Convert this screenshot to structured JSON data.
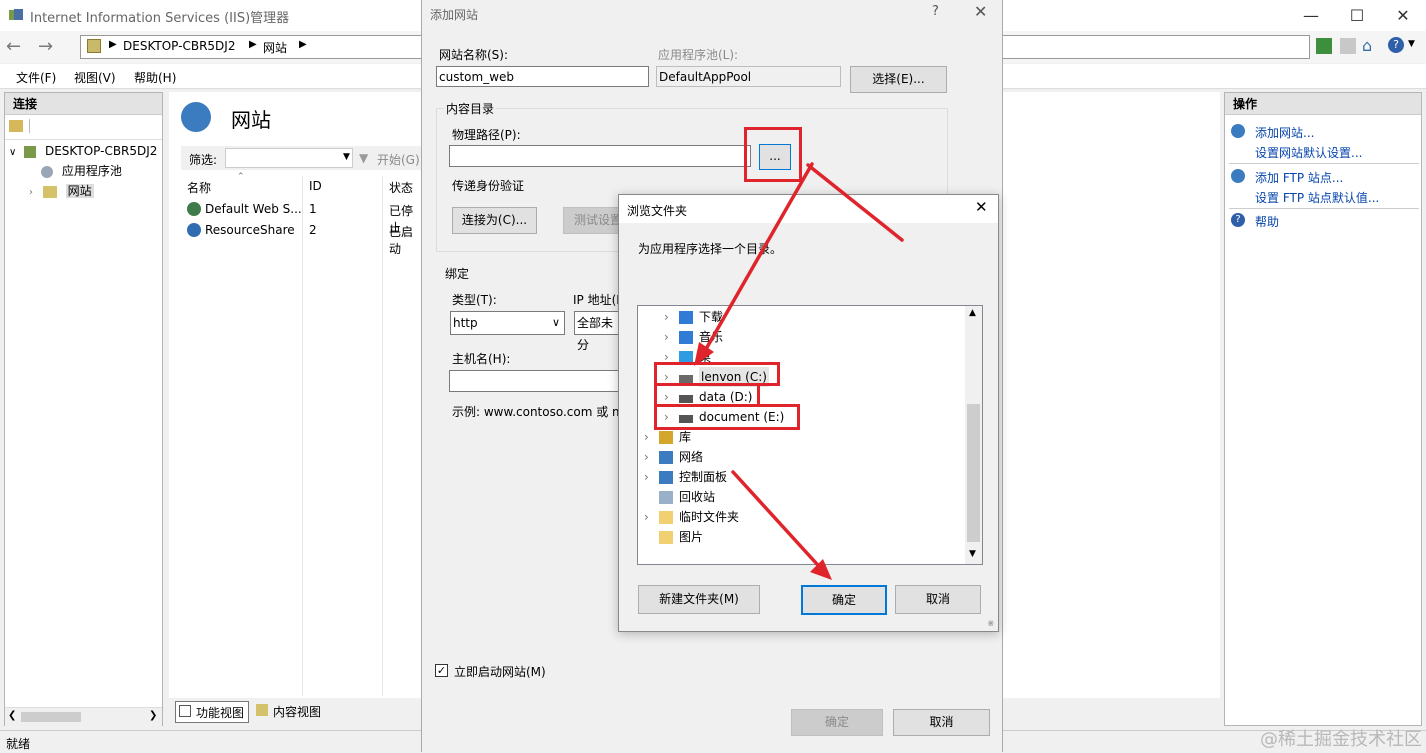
{
  "window": {
    "title": "Internet Information Services (IIS)管理器",
    "address_parts": [
      "DESKTOP-CBR5DJ2",
      "网站"
    ]
  },
  "menu": [
    "文件(F)",
    "视图(V)",
    "帮助(H)"
  ],
  "connections": {
    "title": "连接",
    "tree": [
      "DESKTOP-CBR5DJ2",
      "应用程序池",
      "网站"
    ]
  },
  "sites": {
    "title": "网站",
    "filter_label": "筛选:",
    "start_label": "开始(G)",
    "columns": [
      "名称",
      "ID",
      "状态"
    ],
    "rows": [
      {
        "name": "Default Web S...",
        "id": "1",
        "status": "已停止"
      },
      {
        "name": "ResourceShare",
        "id": "2",
        "status": "已启动"
      }
    ],
    "bottom_tabs": [
      "功能视图",
      "内容视图"
    ]
  },
  "actions": {
    "title": "操作",
    "links": [
      "添加网站...",
      "设置网站默认设置...",
      "添加 FTP 站点...",
      "设置 FTP 站点默认值...",
      "帮助"
    ]
  },
  "status_bar": "就绪",
  "add_site_dialog": {
    "title": "添加网站",
    "help": "?",
    "site_name_label": "网站名称(S):",
    "site_name_value": "custom_web",
    "app_pool_label": "应用程序池(L):",
    "app_pool_value": "DefaultAppPool",
    "select_button": "选择(E)...",
    "content_dir_label": "内容目录",
    "physical_path_label": "物理路径(P):",
    "physical_path_value": "",
    "browse_button": "...",
    "pass_auth_label": "传递身份验证",
    "connect_as_button": "连接为(C)...",
    "test_settings_button": "测试设置",
    "binding_label": "绑定",
    "type_label": "类型(T):",
    "type_value": "http",
    "ip_label": "IP 地址(I",
    "ip_value": "全部未分",
    "hostname_label": "主机名(H):",
    "hostname_value": "",
    "example_text": "示例: www.contoso.com 或 m",
    "start_immediately_label": "立即启动网站(M)",
    "start_immediately_checked": true,
    "ok_button": "确定",
    "cancel_button": "取消"
  },
  "browse_dialog": {
    "title": "浏览文件夹",
    "prompt": "为应用程序选择一个目录。",
    "tree": [
      {
        "label": "下载",
        "icon": "download-icon",
        "level": 2,
        "expandable": true
      },
      {
        "label": "音乐",
        "icon": "music-icon",
        "level": 2,
        "expandable": true
      },
      {
        "label": "桌",
        "icon": "desktop-icon",
        "level": 2,
        "expandable": true
      },
      {
        "label": "lenvon (C:)",
        "icon": "drive-c-icon",
        "level": 2,
        "expandable": true,
        "highlighted": true
      },
      {
        "label": "data (D:)",
        "icon": "drive-icon",
        "level": 2,
        "expandable": true
      },
      {
        "label": "document (E:)",
        "icon": "drive-icon",
        "level": 2,
        "expandable": true
      },
      {
        "label": "库",
        "icon": "library-icon",
        "level": 1,
        "expandable": true
      },
      {
        "label": "网络",
        "icon": "network-icon",
        "level": 1,
        "expandable": true
      },
      {
        "label": "控制面板",
        "icon": "control-panel-icon",
        "level": 1,
        "expandable": true
      },
      {
        "label": "回收站",
        "icon": "recycle-bin-icon",
        "level": 1,
        "expandable": false
      },
      {
        "label": "临时文件夹",
        "icon": "folder-icon",
        "level": 1,
        "expandable": true
      },
      {
        "label": "图片",
        "icon": "folder-icon",
        "level": 1,
        "expandable": false
      }
    ],
    "new_folder_button": "新建文件夹(M)",
    "ok_button": "确定",
    "cancel_button": "取消"
  },
  "watermark": "@稀土掘金技术社区",
  "colors": {
    "annotation": "#e0242c",
    "link": "#0645ad",
    "focus": "#0078d7"
  }
}
